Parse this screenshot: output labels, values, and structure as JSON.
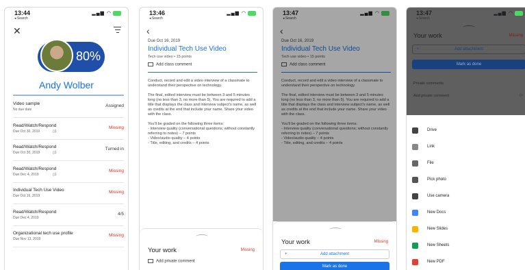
{
  "colors": {
    "accent": "#1a73e8",
    "missing": "#d93025",
    "pill": "#1f4fa8"
  },
  "phone1": {
    "time": "13:44",
    "back": "◂ Search",
    "close_icon": "close-icon",
    "filter_icon": "filter-icon",
    "progress": "80%",
    "student": "Andy Wolber",
    "rows": [
      {
        "title": "Video sample",
        "sub": "No due date",
        "status": "Assigned",
        "kind": "grey"
      },
      {
        "title": "Read/Watch/Respond",
        "sub": "Due Oct 30, 2019",
        "status": "Missing",
        "kind": "missing",
        "attach": "▯1"
      },
      {
        "title": "Read/Watch/Respond",
        "sub": "Due Oct 30, 2019",
        "status": "Turned in",
        "kind": "grey",
        "attach": "▯1"
      },
      {
        "title": "Read/Watch/Respond",
        "sub": "Due Dec 4, 2019",
        "status": "Missing",
        "kind": "missing",
        "attach": "▯1"
      },
      {
        "title": "Individual Tech Use Video",
        "sub": "Due Oct 16, 2019",
        "status": "Missing",
        "kind": "missing"
      },
      {
        "title": "Read/Watch/Respond",
        "sub": "Due Dec 4, 2019",
        "status": "4/5",
        "kind": "grey"
      },
      {
        "title": "Organizational tech use profile",
        "sub": "Due Nov 13, 2019",
        "status": "Missing",
        "kind": "missing"
      }
    ]
  },
  "assignment": {
    "due": "Due Oct 16, 2019",
    "title": "Individual Tech Use Video",
    "meta": "Tech use video • 15 points",
    "class_comment": "Add class comment",
    "body": "Conduct, record and edit a video interview of a classmate to understand their perspective on technology.\n\nThe final, edited interview must be between 3 and 5 minutes long (no less than 3, no more than 5). You are required to add a title that displays the class and interview subject's name, as well as credits at the end that include your name. Share your video with the class.\n\nYou'll be graded on the following three items:\n- Interview quality (conversational questions; without constantly referring to notes) – 7 points\n- Video/audio quality – 4 points\n- Title, editing, and credits – 4 points",
    "your_work": "Your work",
    "missing": "Missing",
    "private_comment": "Add private comment",
    "add_attachment": "Add attachment",
    "mark_done": "Mark as done"
  },
  "phone2": {
    "time": "13:46",
    "back": "◂ Search"
  },
  "phone3": {
    "time": "13:47",
    "back": "◂ Search"
  },
  "phone4": {
    "time": "13:47",
    "back": "◂ Search",
    "private_comments": "Private comments",
    "add_private": "Add private comment",
    "menu": [
      {
        "label": "Drive",
        "icon": "drive-icon",
        "color": "#444"
      },
      {
        "label": "Link",
        "icon": "link-icon",
        "color": "#888"
      },
      {
        "label": "File",
        "icon": "upload-icon",
        "color": "#666"
      },
      {
        "label": "Pick photo",
        "icon": "photo-icon",
        "color": "#555"
      },
      {
        "label": "Use camera",
        "icon": "camera-icon",
        "color": "#444"
      },
      {
        "label": "New Docs",
        "icon": "docs-icon",
        "color": "#4285f4"
      },
      {
        "label": "New Slides",
        "icon": "slides-icon",
        "color": "#f4b400"
      },
      {
        "label": "New Sheets",
        "icon": "sheets-icon",
        "color": "#0f9d58"
      },
      {
        "label": "New PDF",
        "icon": "pdf-icon",
        "color": "#db4437"
      }
    ]
  }
}
